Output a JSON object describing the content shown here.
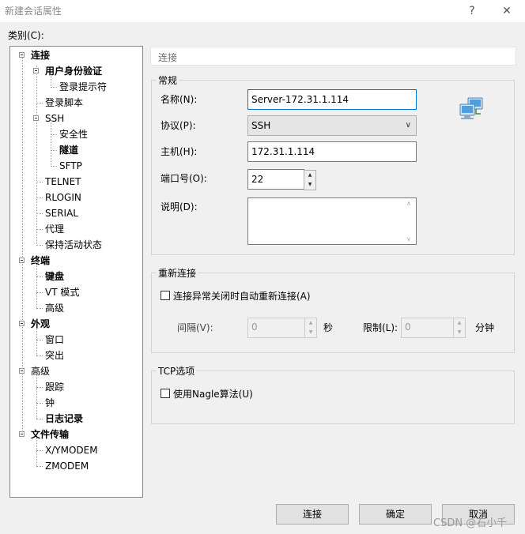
{
  "window": {
    "title": "新建会话属性",
    "help_label": "?",
    "close_label": "✕"
  },
  "category_label": "类别(C):",
  "tree": [
    {
      "label": "连接",
      "bold": true
    },
    {
      "label": "用户身份验证",
      "bold": true
    },
    {
      "label": "登录提示符",
      "bold": false
    },
    {
      "label": "登录脚本",
      "bold": false
    },
    {
      "label": "SSH",
      "bold": false
    },
    {
      "label": "安全性",
      "bold": false
    },
    {
      "label": "隧道",
      "bold": true
    },
    {
      "label": "SFTP",
      "bold": false
    },
    {
      "label": "TELNET",
      "bold": false
    },
    {
      "label": "RLOGIN",
      "bold": false
    },
    {
      "label": "SERIAL",
      "bold": false
    },
    {
      "label": "代理",
      "bold": false
    },
    {
      "label": "保持活动状态",
      "bold": false
    },
    {
      "label": "终端",
      "bold": true
    },
    {
      "label": "键盘",
      "bold": true
    },
    {
      "label": "VT 模式",
      "bold": false
    },
    {
      "label": "高级",
      "bold": false
    },
    {
      "label": "外观",
      "bold": true
    },
    {
      "label": "窗口",
      "bold": false
    },
    {
      "label": "突出",
      "bold": false
    },
    {
      "label": "高级",
      "bold": false
    },
    {
      "label": "跟踪",
      "bold": false
    },
    {
      "label": "钟",
      "bold": false
    },
    {
      "label": "日志记录",
      "bold": true
    },
    {
      "label": "文件传输",
      "bold": true
    },
    {
      "label": "X/YMODEM",
      "bold": false
    },
    {
      "label": "ZMODEM",
      "bold": false
    }
  ],
  "header": "连接",
  "general": {
    "title": "常规",
    "name_label": "名称(N):",
    "name_value": "Server-172.31.1.114",
    "protocol_label": "协议(P):",
    "protocol_value": "SSH",
    "host_label": "主机(H):",
    "host_value": "172.31.1.114",
    "port_label": "端口号(O):",
    "port_value": "22",
    "desc_label": "说明(D):",
    "desc_value": ""
  },
  "reconnect": {
    "title": "重新连接",
    "checkbox_label": "连接异常关闭时自动重新连接(A)",
    "checked": false,
    "interval_label": "间隔(V):",
    "interval_value": "0",
    "interval_unit": "秒",
    "limit_label": "限制(L):",
    "limit_value": "0",
    "limit_unit": "分钟"
  },
  "tcp": {
    "title": "TCP选项",
    "nagle_label": "使用Nagle算法(U)",
    "checked": false
  },
  "buttons": {
    "connect": "连接",
    "ok": "确定",
    "cancel": "取消"
  },
  "watermark": "CSDN @石小千"
}
